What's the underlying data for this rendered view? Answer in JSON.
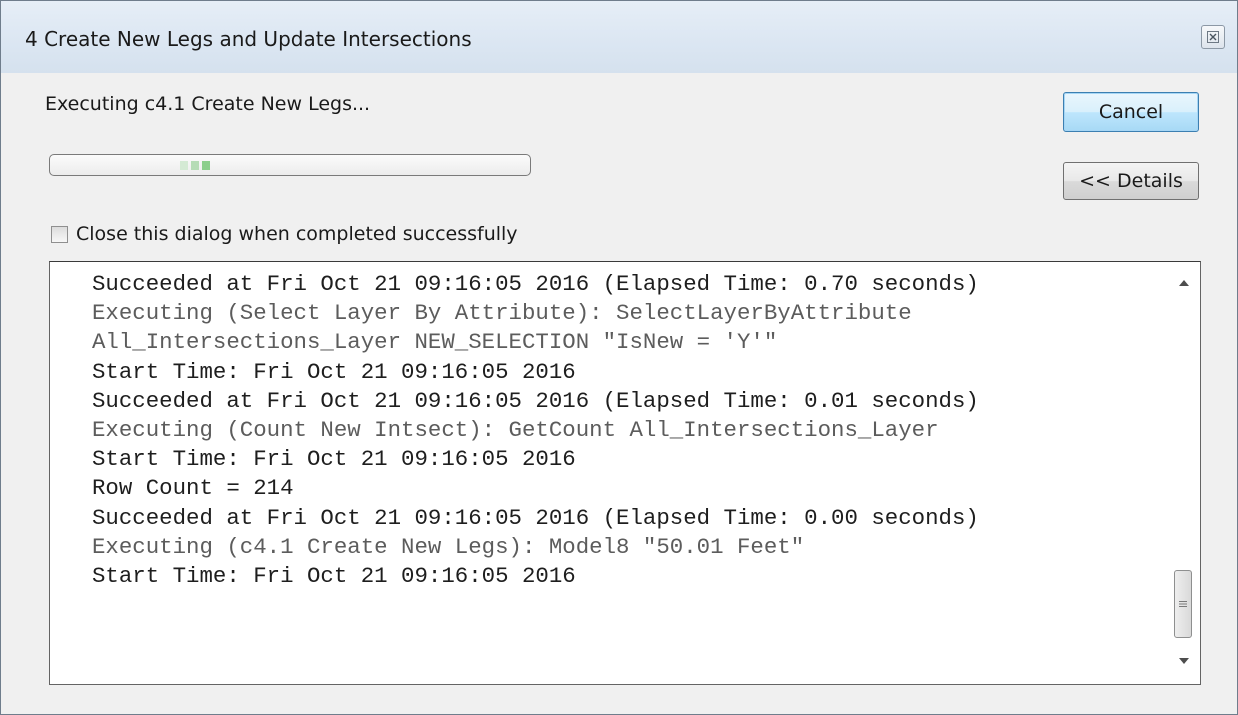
{
  "window": {
    "title": "4 Create New Legs and Update Intersections"
  },
  "status": {
    "text": "Executing c4.1 Create New Legs..."
  },
  "buttons": {
    "cancel": "Cancel",
    "details": "<< Details"
  },
  "checkbox": {
    "label": "Close this dialog when completed successfully",
    "checked": false
  },
  "progress": {
    "mode": "marquee",
    "chunk_colors": [
      "#d4ead4",
      "#b6dcb6",
      "#8ccf8c"
    ]
  },
  "log": {
    "lines": [
      {
        "text": "Succeeded at Fri Oct 21 09:16:05 2016 (Elapsed Time: 0.70 seconds)",
        "kind": "normal"
      },
      {
        "text": "Executing (Select Layer By Attribute): SelectLayerByAttribute",
        "kind": "exec"
      },
      {
        "text": "All_Intersections_Layer NEW_SELECTION \"IsNew = 'Y'\"",
        "kind": "exec"
      },
      {
        "text": "Start Time: Fri Oct 21 09:16:05 2016",
        "kind": "normal"
      },
      {
        "text": "Succeeded at Fri Oct 21 09:16:05 2016 (Elapsed Time: 0.01 seconds)",
        "kind": "normal"
      },
      {
        "text": "Executing (Count New Intsect): GetCount All_Intersections_Layer",
        "kind": "exec"
      },
      {
        "text": "Start Time: Fri Oct 21 09:16:05 2016",
        "kind": "normal"
      },
      {
        "text": "Row Count = 214",
        "kind": "normal"
      },
      {
        "text": "Succeeded at Fri Oct 21 09:16:05 2016 (Elapsed Time: 0.00 seconds)",
        "kind": "normal"
      },
      {
        "text": "Executing (c4.1 Create New Legs): Model8 \"50.01 Feet\"",
        "kind": "exec"
      },
      {
        "text": "Start Time: Fri Oct 21 09:16:05 2016",
        "kind": "normal"
      }
    ]
  },
  "icons": {
    "close": "close-icon",
    "scroll_up": "scroll-up-arrow-icon",
    "scroll_down": "scroll-down-arrow-icon",
    "grip": "scroll-grip-icon"
  },
  "colors": {
    "log_normal": "#1e1e1e",
    "log_exec": "#5c5c5c",
    "cancel_accent": "#3c7fb1"
  }
}
